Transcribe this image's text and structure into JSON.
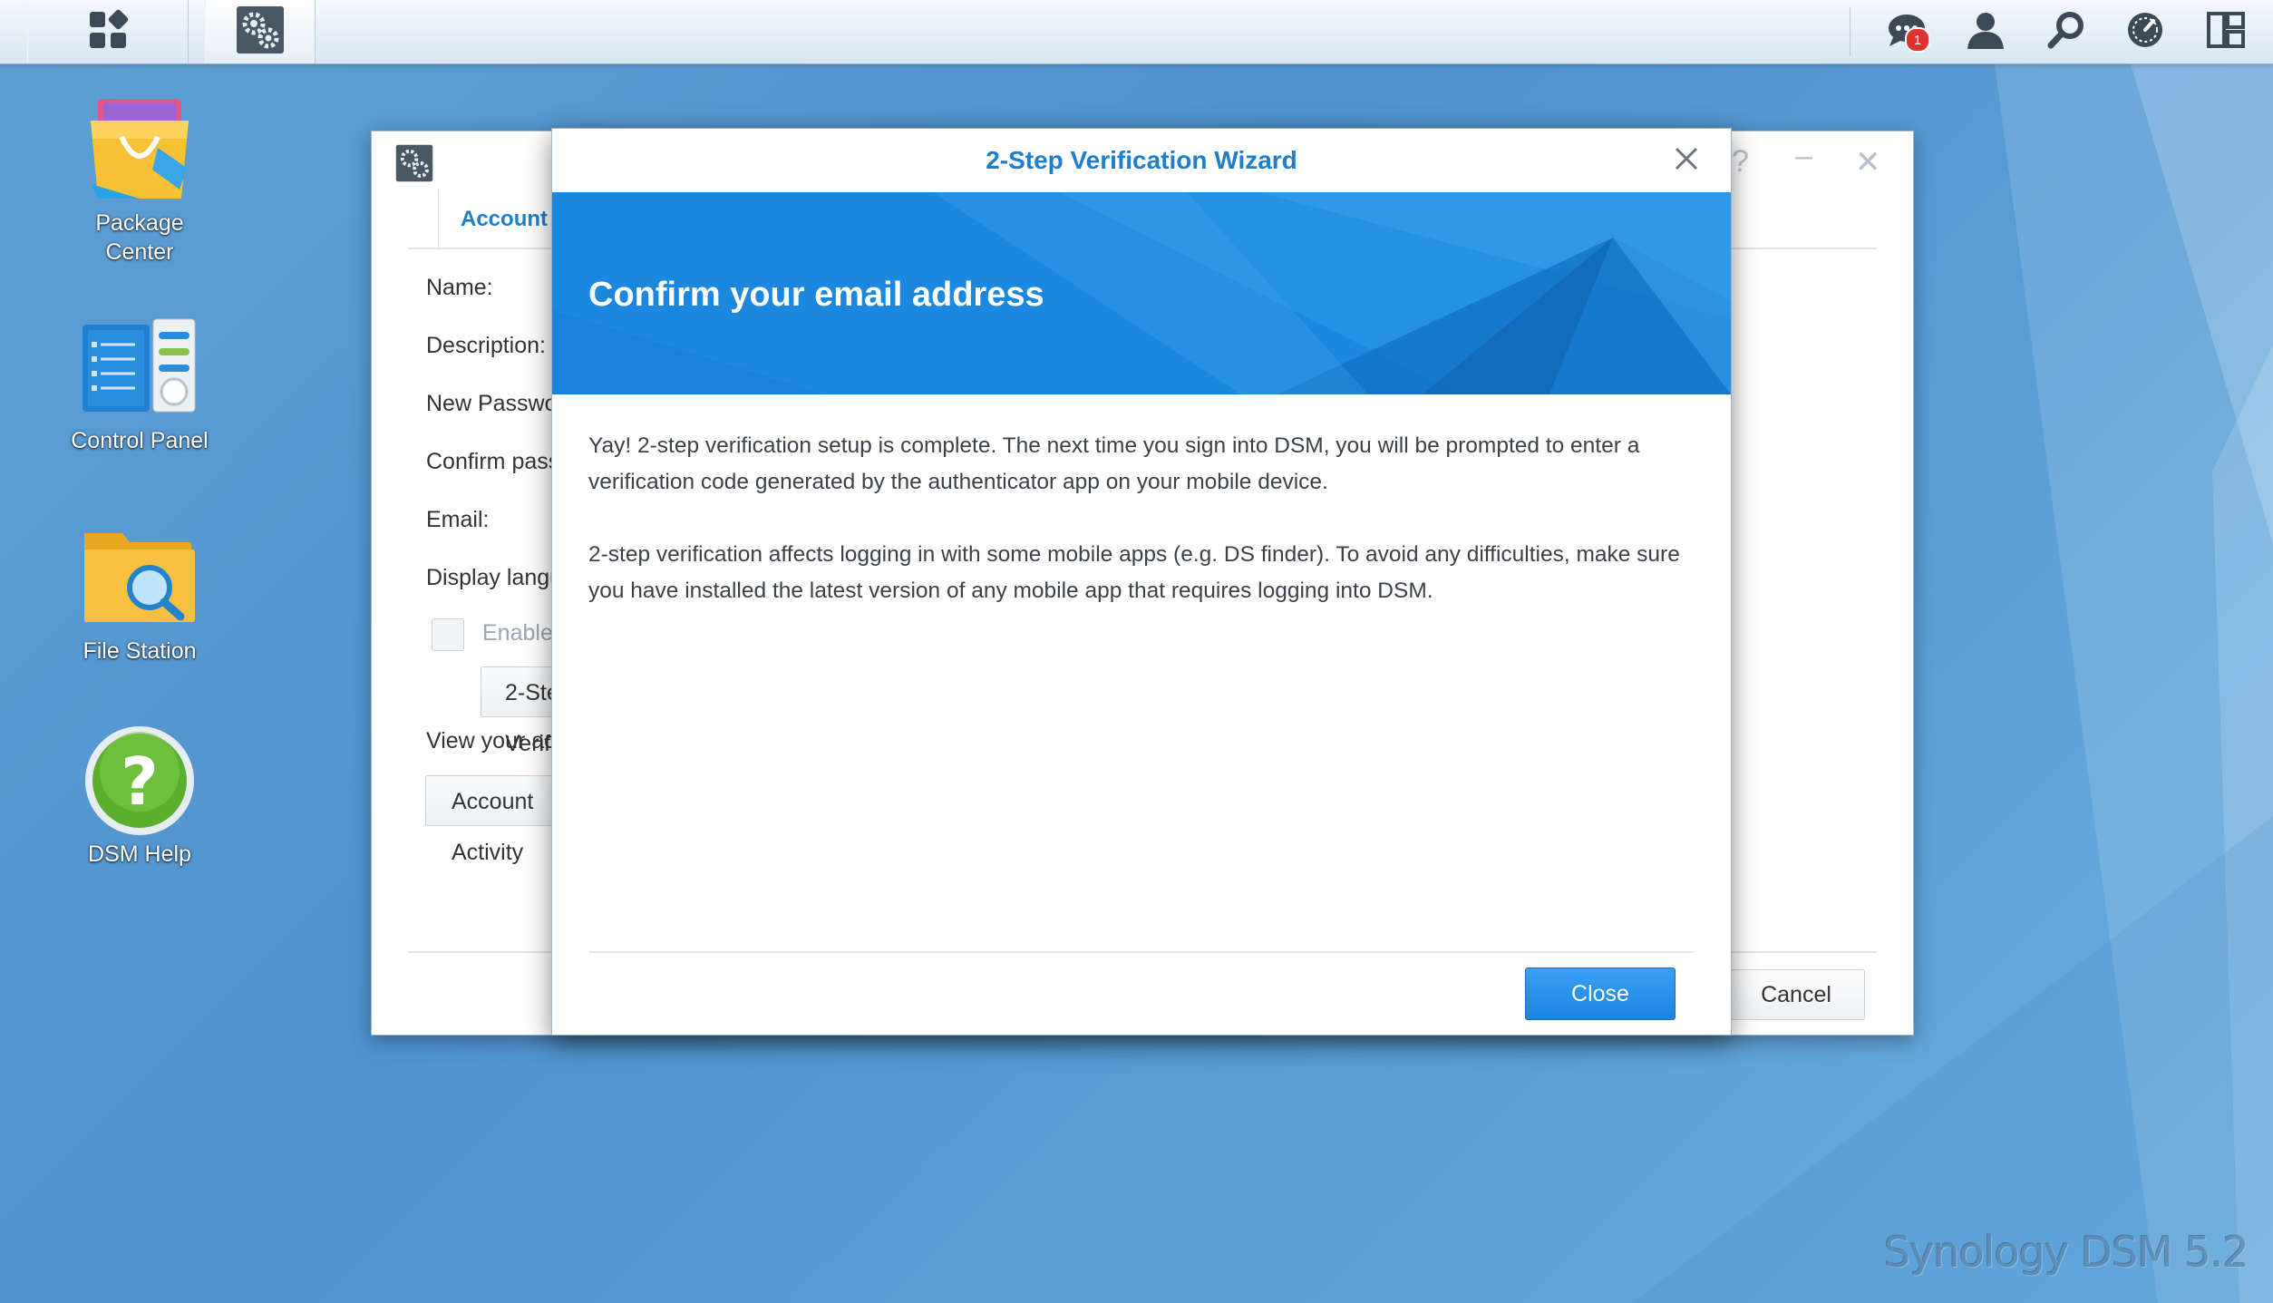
{
  "taskbar": {
    "notification_count": "1",
    "icons": [
      "main-menu-icon",
      "control-panel-icon",
      "notifications-icon",
      "user-icon",
      "search-icon",
      "widgets-icon",
      "window-overview-icon"
    ]
  },
  "desktop": {
    "icons": [
      {
        "label": "Package\nCenter",
        "icon": "package-center-icon"
      },
      {
        "label": "Control Panel",
        "icon": "control-panel-icon"
      },
      {
        "label": "File Station",
        "icon": "file-station-icon"
      },
      {
        "label": "DSM Help",
        "icon": "dsm-help-icon"
      }
    ],
    "brand": "Synology DSM 5.2"
  },
  "personal_window": {
    "tab": "Account",
    "fields": [
      "Name:",
      "Description:",
      "New Password:",
      "Confirm password:",
      "Email:",
      "Display language:"
    ],
    "enable_checkbox_label": "Enable",
    "two_step_button": "2-Step Verification",
    "view_label": "View your account activity",
    "account_activity_button": "Account Activity",
    "cancel_button": "Cancel"
  },
  "wizard": {
    "title": "2-Step Verification Wizard",
    "heading": "Confirm your email address",
    "paragraph1": "Yay! 2-step verification setup is complete. The next time you sign into DSM, you will be prompted to enter a verification code generated by the authenticator app on your mobile device.",
    "paragraph2": "2-step verification affects logging in with some mobile apps (e.g. DS finder). To avoid any difficulties, make sure you have installed the latest version of any mobile app that requires logging into DSM.",
    "close_button": "Close"
  },
  "colors": {
    "accent": "#1f7ed0",
    "banner": "#1b87de",
    "badge": "#e2322f"
  }
}
